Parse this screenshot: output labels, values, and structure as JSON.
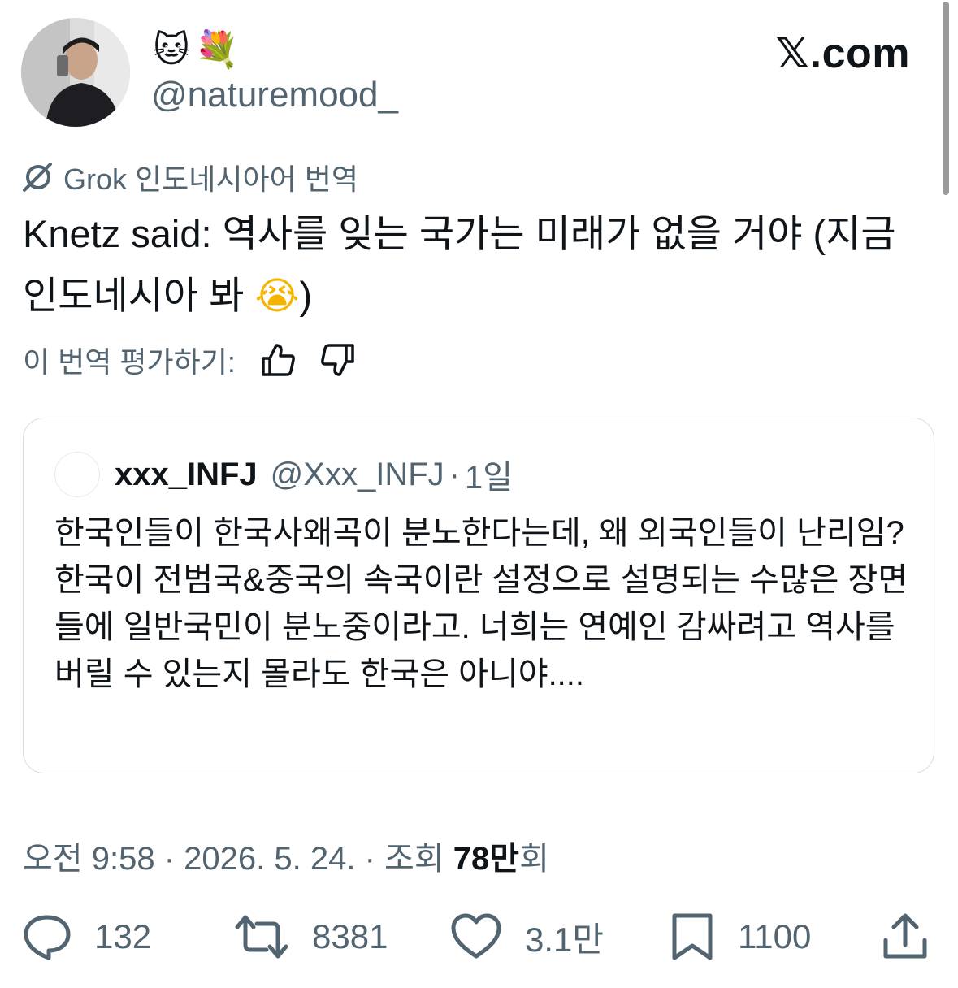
{
  "author": {
    "name_emojis": [
      "🐱",
      "💐"
    ],
    "handle": "@naturemood_"
  },
  "brand": {
    "logo_text": "𝕏.com"
  },
  "translation": {
    "provider_label": "Grok 인도네시아어 번역"
  },
  "tweet": {
    "text": "Knetz said: 역사를 잊는 국가는 미래가 없을 거야 (지금 인도네시아 봐 ",
    "emoji": "😭",
    "text_end": ")"
  },
  "rating": {
    "label": "이 번역 평가하기:"
  },
  "quote": {
    "name": "xxx_INFJ",
    "handle": "@Xxx_INFJ",
    "separator": "·",
    "time": "1일",
    "body": "한국인들이 한국사왜곡이 분노한다는데, 왜 외국인들이 난리임?\n한국이 전범국&중국의 속국이란 설정으로 설명되는 수많은 장면들에 일반국민이 분노중이라고. 너희는 연예인 감싸려고 역사를 버릴 수 있는지 몰라도 한국은 아니야...."
  },
  "meta": {
    "time": "오전 9:58",
    "date": "2026. 5. 24.",
    "sep": "·",
    "views_label": "조회",
    "views_count": "78만",
    "views_suffix": "회"
  },
  "actions": {
    "replies": "132",
    "reposts": "8381",
    "likes": "3.1만",
    "bookmarks": "1100"
  },
  "colors": {
    "text": "#0f1419",
    "secondary": "#536471",
    "border": "#d6dde3"
  }
}
